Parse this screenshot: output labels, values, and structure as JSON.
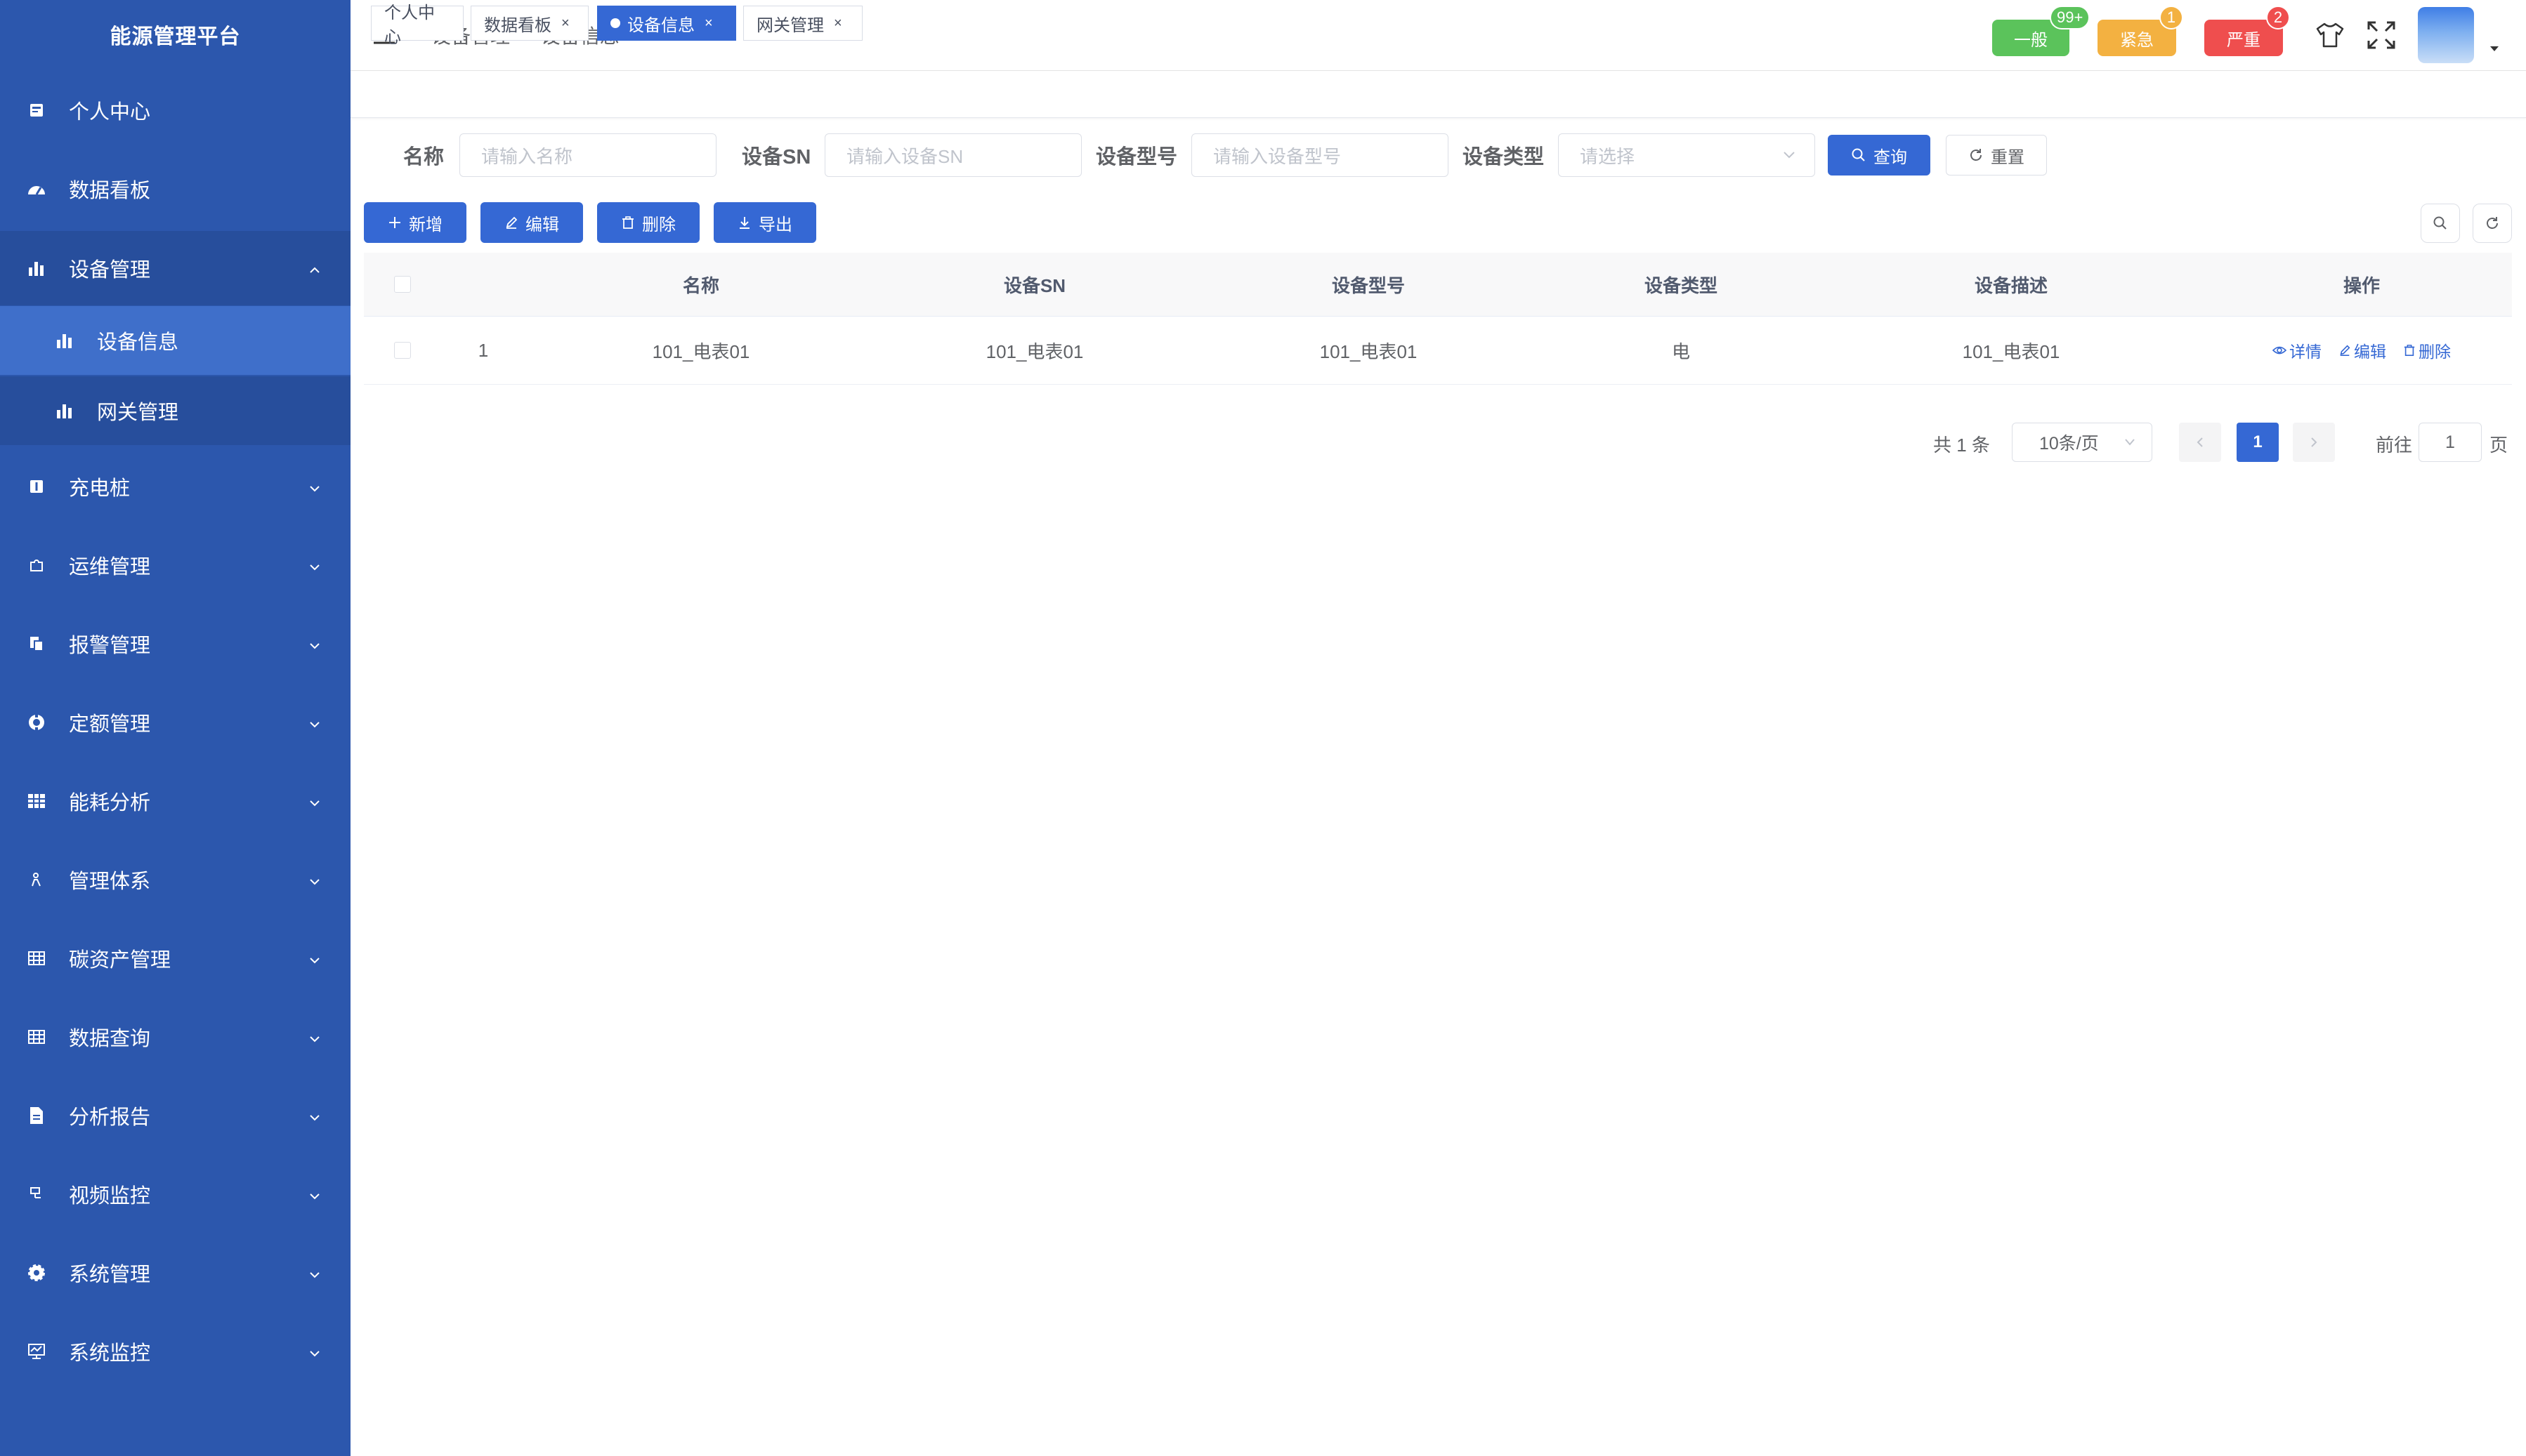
{
  "app": {
    "title": "能源管理平台"
  },
  "sidebar": {
    "items": [
      {
        "label": "个人中心",
        "icon": "profile-icon"
      },
      {
        "label": "数据看板",
        "icon": "dashboard-icon"
      },
      {
        "label": "设备管理",
        "icon": "bar-chart-icon",
        "expanded": true,
        "children": [
          {
            "label": "设备信息",
            "icon": "bar-chart-icon",
            "active": true
          },
          {
            "label": "网关管理",
            "icon": "bar-chart-icon"
          }
        ]
      },
      {
        "label": "充电桩",
        "icon": "info-icon"
      },
      {
        "label": "运维管理",
        "icon": "puzzle-icon"
      },
      {
        "label": "报警管理",
        "icon": "copy-icon"
      },
      {
        "label": "定额管理",
        "icon": "lifebuoy-icon"
      },
      {
        "label": "能耗分析",
        "icon": "grid-icon"
      },
      {
        "label": "管理体系",
        "icon": "user-icon"
      },
      {
        "label": "碳资产管理",
        "icon": "table-icon"
      },
      {
        "label": "数据查询",
        "icon": "table-icon"
      },
      {
        "label": "分析报告",
        "icon": "document-icon"
      },
      {
        "label": "视频监控",
        "icon": "video-icon"
      },
      {
        "label": "系统管理",
        "icon": "gear-icon"
      },
      {
        "label": "系统监控",
        "icon": "monitor-icon"
      }
    ]
  },
  "header": {
    "breadcrumb": [
      "设备管理",
      "设备信息"
    ],
    "alerts": [
      {
        "label": "一般",
        "count": "99+",
        "color": "#5bc35b",
        "badge_color": "#5bc35b"
      },
      {
        "label": "紧急",
        "count": "1",
        "color": "#f3b141",
        "badge_color": "#f3b141"
      },
      {
        "label": "严重",
        "count": "2",
        "color": "#ef4e4e",
        "badge_color": "#ef4e4e"
      }
    ]
  },
  "tags": [
    {
      "label": "个人中心",
      "closable": false,
      "active": false
    },
    {
      "label": "数据看板",
      "closable": true,
      "active": false
    },
    {
      "label": "设备信息",
      "closable": true,
      "active": true
    },
    {
      "label": "网关管理",
      "closable": true,
      "active": false
    }
  ],
  "search": {
    "name_label": "名称",
    "name_placeholder": "请输入名称",
    "sn_label": "设备SN",
    "sn_placeholder": "请输入设备SN",
    "model_label": "设备型号",
    "model_placeholder": "请输入设备型号",
    "type_label": "设备类型",
    "type_placeholder": "请选择",
    "query_button": "查询",
    "reset_button": "重置"
  },
  "toolbar": {
    "add": "新增",
    "edit": "编辑",
    "delete": "删除",
    "export": "导出"
  },
  "table": {
    "columns": [
      "名称",
      "设备SN",
      "设备型号",
      "设备类型",
      "设备描述",
      "操作"
    ],
    "rows": [
      {
        "index": "1",
        "name": "101_电表01",
        "sn": "101_电表01",
        "model": "101_电表01",
        "type": "电",
        "desc": "101_电表01"
      }
    ],
    "actions": {
      "detail": "详情",
      "edit": "编辑",
      "delete": "删除"
    }
  },
  "pagination": {
    "total_text": "共 1 条",
    "page_size": "10条/页",
    "current_page": "1",
    "goto_label": "前往",
    "goto_value": "1",
    "page_suffix": "页"
  },
  "colors": {
    "sidebar": "#2c57ad",
    "primary": "#3568d4"
  }
}
